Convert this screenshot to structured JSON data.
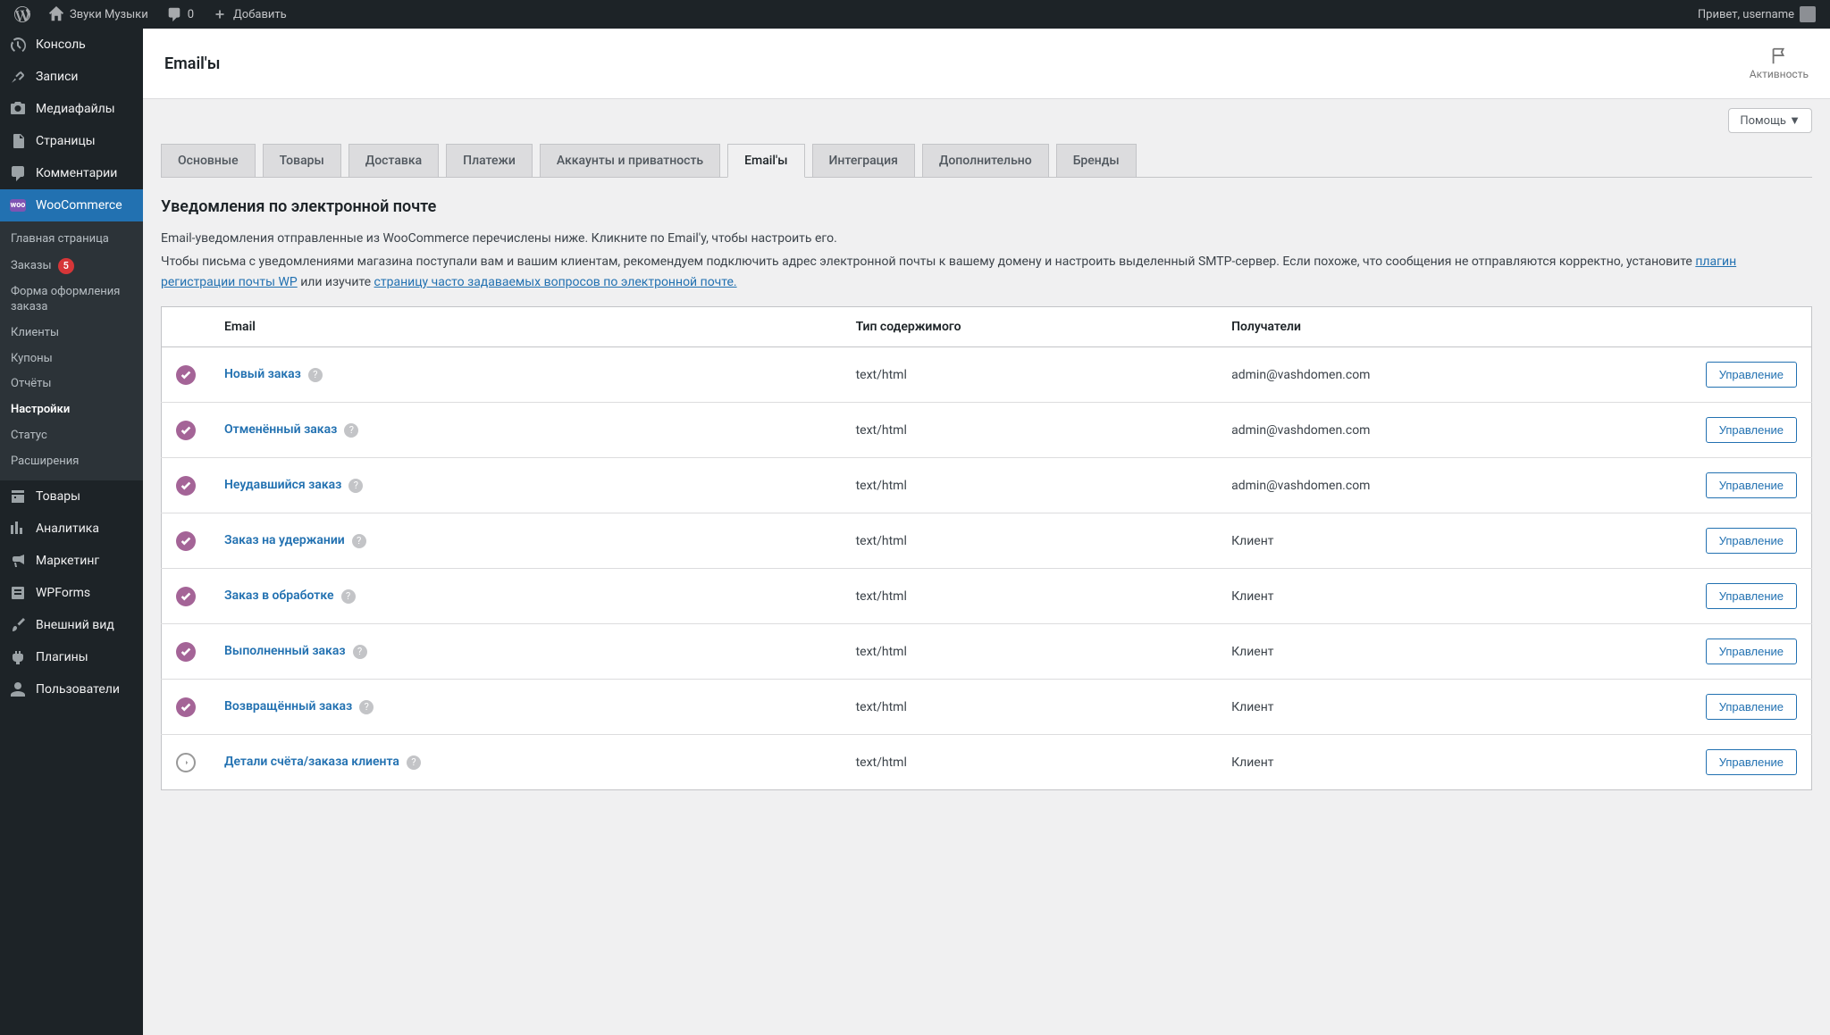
{
  "adminbar": {
    "site_name": "Звуки Музыки",
    "comments_count": "0",
    "add_new": "Добавить",
    "greeting": "Привет, username"
  },
  "sidebar": {
    "items": [
      {
        "label": "Консоль",
        "icon": "dashboard"
      },
      {
        "label": "Записи",
        "icon": "pin"
      },
      {
        "label": "Медиафайлы",
        "icon": "media"
      },
      {
        "label": "Страницы",
        "icon": "pages"
      },
      {
        "label": "Комментарии",
        "icon": "comments"
      },
      {
        "label": "WooCommerce",
        "icon": "woo",
        "current": true
      },
      {
        "label": "Товары",
        "icon": "products"
      },
      {
        "label": "Аналитика",
        "icon": "analytics"
      },
      {
        "label": "Маркетинг",
        "icon": "marketing"
      },
      {
        "label": "WPForms",
        "icon": "wpforms"
      },
      {
        "label": "Внешний вид",
        "icon": "appearance"
      },
      {
        "label": "Плагины",
        "icon": "plugins"
      },
      {
        "label": "Пользователи",
        "icon": "users"
      }
    ],
    "submenu": [
      {
        "label": "Главная страница"
      },
      {
        "label": "Заказы",
        "badge": "5"
      },
      {
        "label": "Форма оформления заказа"
      },
      {
        "label": "Клиенты"
      },
      {
        "label": "Купоны"
      },
      {
        "label": "Отчёты"
      },
      {
        "label": "Настройки",
        "current": true
      },
      {
        "label": "Статус"
      },
      {
        "label": "Расширения"
      }
    ]
  },
  "header": {
    "title": "Email'ы",
    "activity": "Активность",
    "help": "Помощь ▼"
  },
  "tabs": [
    {
      "label": "Основные"
    },
    {
      "label": "Товары"
    },
    {
      "label": "Доставка"
    },
    {
      "label": "Платежи"
    },
    {
      "label": "Аккаунты и приватность"
    },
    {
      "label": "Email'ы",
      "active": true
    },
    {
      "label": "Интеграция"
    },
    {
      "label": "Дополнительно"
    },
    {
      "label": "Бренды"
    }
  ],
  "section": {
    "title": "Уведомления по электронной почте",
    "desc1": "Email-уведомления отправленные из WooCommerce перечислены ниже. Кликните по Email'у, чтобы настроить его.",
    "desc2_pre": "Чтобы письма с уведомлениями магазина поступали вам и вашим клиентам, рекомендуем подключить адрес электронной почты к вашему домену и настроить выделенный SMTP-сервер. Если похоже, что сообщения не отправляются корректно, установите ",
    "desc2_link1": "плагин регистрации почты WP",
    "desc2_mid": " или изучите ",
    "desc2_link2": "страницу часто задаваемых вопросов по электронной почте."
  },
  "table": {
    "columns": {
      "status": "",
      "email": "Email",
      "type": "Тип содержимого",
      "recipients": "Получатели",
      "action": ""
    },
    "manage_label": "Управление",
    "rows": [
      {
        "enabled": true,
        "name": "Новый заказ",
        "type": "text/html",
        "recipients": "admin@vashdomen.com"
      },
      {
        "enabled": true,
        "name": "Отменённый заказ",
        "type": "text/html",
        "recipients": "admin@vashdomen.com"
      },
      {
        "enabled": true,
        "name": "Неудавшийся заказ",
        "type": "text/html",
        "recipients": "admin@vashdomen.com"
      },
      {
        "enabled": true,
        "name": "Заказ на удержании",
        "type": "text/html",
        "recipients": "Клиент"
      },
      {
        "enabled": true,
        "name": "Заказ в обработке",
        "type": "text/html",
        "recipients": "Клиент"
      },
      {
        "enabled": true,
        "name": "Выполненный заказ",
        "type": "text/html",
        "recipients": "Клиент"
      },
      {
        "enabled": true,
        "name": "Возвращённый заказ",
        "type": "text/html",
        "recipients": "Клиент"
      },
      {
        "enabled": false,
        "name": "Детали счёта/заказа клиента",
        "type": "text/html",
        "recipients": "Клиент"
      }
    ]
  }
}
